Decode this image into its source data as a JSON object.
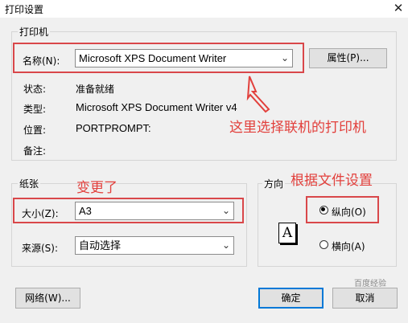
{
  "window": {
    "title": "打印设置",
    "close_glyph": "✕"
  },
  "printer_group": {
    "legend": "打印机",
    "name_label": "名称(N):",
    "name_value": "Microsoft XPS Document Writer",
    "properties_button": "属性(P)...",
    "status_label": "状态:",
    "status_value": "准备就绪",
    "type_label": "类型:",
    "type_value": "Microsoft XPS Document Writer v4",
    "location_label": "位置:",
    "location_value": "PORTPROMPT:",
    "comment_label": "备注:",
    "comment_value": ""
  },
  "paper_group": {
    "legend": "纸张",
    "size_label": "大小(Z):",
    "size_value": "A3",
    "source_label": "来源(S):",
    "source_value": "自动选择"
  },
  "orientation_group": {
    "legend": "方向",
    "portrait_label": "纵向(O)",
    "landscape_label": "横向(A)",
    "selected": "portrait",
    "icon_letter": "A"
  },
  "buttons": {
    "network": "网络(W)...",
    "ok": "确定",
    "cancel": "取消"
  },
  "annotations": {
    "printer_note": "这里选择联机的打印机",
    "paper_note": "变更了",
    "orientation_note": "根据文件设置",
    "color": "#e2403c"
  },
  "watermark": {
    "text": "百度经验"
  }
}
